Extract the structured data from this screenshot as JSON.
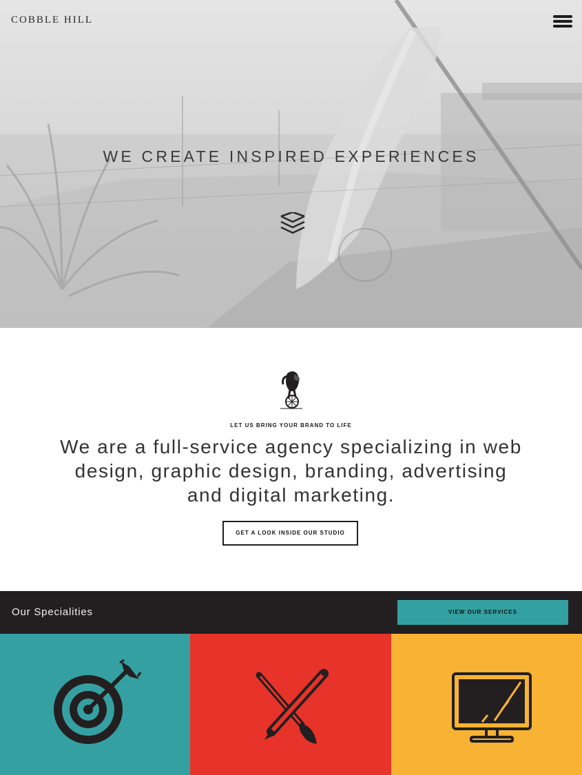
{
  "header": {
    "logo_text": "COBBLE HILL",
    "menu_icon": "hamburger-icon"
  },
  "hero": {
    "headline": "WE CREATE INSPIRED EXPERIENCES",
    "scroll_icon": "chevrons-down-icon"
  },
  "intro": {
    "mascot_icon": "elephant-on-unicycle-icon",
    "eyebrow": "LET US BRING YOUR BRAND TO LIFE",
    "lead": "We are a full-service agency specializing in web design, graphic design, branding, advertising and digital marketing.",
    "studio_button": "GET A LOOK INSIDE OUR STUDIO"
  },
  "specialities": {
    "title": "Our Specialities",
    "services_button": "VIEW OUR SERVICES",
    "tiles": [
      {
        "icon": "target-arrow-icon",
        "color": "#35a0a2"
      },
      {
        "icon": "pencil-brush-icon",
        "color": "#e8332a"
      },
      {
        "icon": "monitor-icon",
        "color": "#f8b334"
      }
    ]
  },
  "colors": {
    "dark": "#231f20",
    "teal": "#35a0a2",
    "red": "#e8332a",
    "yellow": "#f8b334"
  }
}
